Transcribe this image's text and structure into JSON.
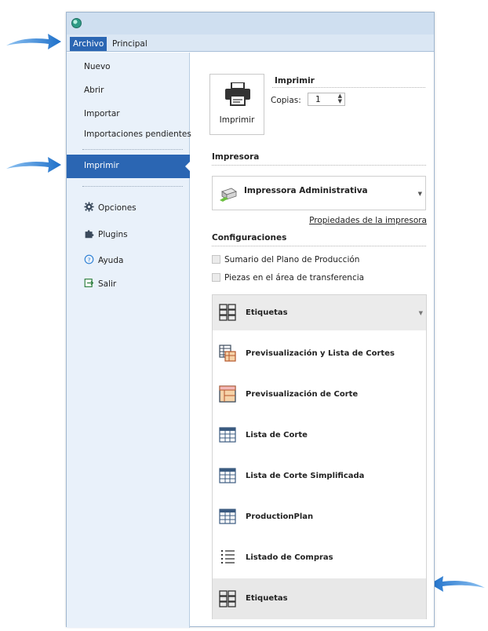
{
  "ribbon": {
    "tabs": [
      {
        "label": "Archivo",
        "active": true
      },
      {
        "label": "Principal",
        "active": false
      }
    ]
  },
  "sidebar": {
    "items": [
      {
        "label": "Nuevo"
      },
      {
        "label": "Abrir"
      },
      {
        "label": "Importar"
      },
      {
        "label": "Importaciones pendientes"
      },
      {
        "label": "Imprimir",
        "active": true
      },
      {
        "label": "Opciones",
        "icon": "gear-icon"
      },
      {
        "label": "Plugins",
        "icon": "puzzle-icon"
      },
      {
        "label": "Ayuda",
        "icon": "help-icon"
      },
      {
        "label": "Salir",
        "icon": "exit-icon"
      }
    ]
  },
  "print": {
    "button_label": "Imprimir",
    "section_title": "Imprimir",
    "copies_label": "Copias:",
    "copies_value": "1"
  },
  "printer": {
    "section_title": "Impresora",
    "selected": "Impressora Administrativa",
    "properties_link": "Propiedades de la impresora"
  },
  "config": {
    "section_title": "Configuraciones",
    "options": [
      {
        "label": "Sumario del Plano de Producción",
        "checked": false
      },
      {
        "label": "Piezas en el área de transferencia",
        "checked": false
      }
    ]
  },
  "report_select": {
    "selected": "Etiquetas",
    "options": [
      {
        "label": "Previsualización y Lista de Cortes",
        "icon": "preview-list-icon"
      },
      {
        "label": "Previsualización de Corte",
        "icon": "preview-cut-icon"
      },
      {
        "label": "Lista de Corte",
        "icon": "table-icon"
      },
      {
        "label": "Lista de Corte Simplificada",
        "icon": "table-icon"
      },
      {
        "label": "ProductionPlan",
        "icon": "table-icon"
      },
      {
        "label": "Listado de Compras",
        "icon": "checklist-icon"
      },
      {
        "label": "Etiquetas",
        "icon": "labels-icon",
        "selected": true
      }
    ]
  },
  "colors": {
    "accent": "#2b66b3",
    "arrow": "#2f7fd6",
    "sidebar_bg": "#e9f1fa"
  }
}
